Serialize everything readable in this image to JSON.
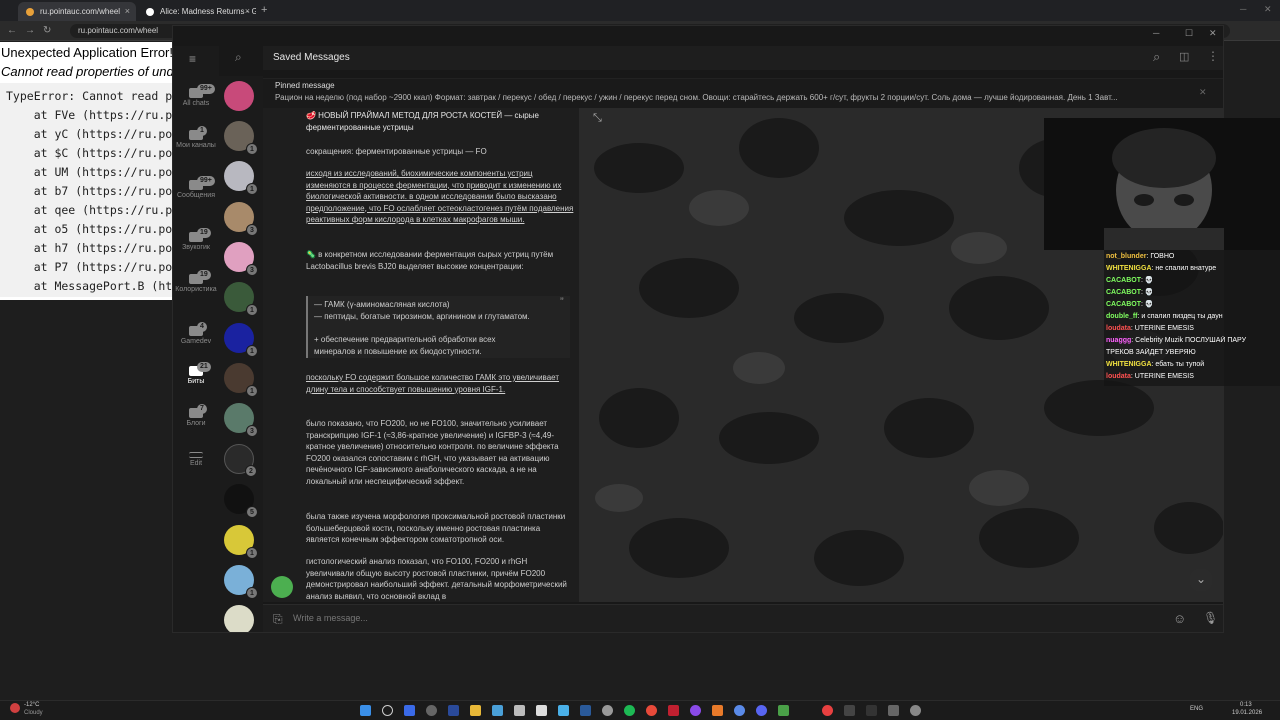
{
  "browser": {
    "tabs": [
      {
        "label": "ru.pointauc.com/wheel"
      },
      {
        "label": "Alice: Madness Returns - Googl"
      }
    ],
    "url": "ru.pointauc.com/wheel"
  },
  "error_page": {
    "title": "Unexpected Application Error!",
    "subtitle": "Cannot read properties of und",
    "trace": [
      "TypeError: Cannot read pr",
      "    at FVe (https://ru.po",
      "    at yC (https://ru.poi",
      "    at $C (https://ru.poi",
      "    at UM (https://ru.poi",
      "    at b7 (https://ru.poi",
      "    at qee (https://ru.po",
      "    at o5 (https://ru.poi",
      "    at h7 (https://ru.poi",
      "    at P7 (https://ru.poi",
      "    at MessagePort.B (htt"
    ]
  },
  "telegram": {
    "chat_title": "Saved Messages",
    "folders": [
      {
        "label": "All chats",
        "badge": "99+"
      },
      {
        "label": "Мои каналы",
        "badge": "1"
      },
      {
        "label": "Сообщения",
        "badge": "99+"
      },
      {
        "label": "Звукогик",
        "badge": "19"
      },
      {
        "label": "Колористика",
        "badge": "19"
      },
      {
        "label": "Gamedev",
        "badge": "4"
      },
      {
        "label": "Биты",
        "badge": "21"
      },
      {
        "label": "Блоги",
        "badge": "7"
      },
      {
        "label": "Edit",
        "badge": ""
      }
    ],
    "chat_badges": [
      "",
      "1",
      "1",
      "3",
      "3",
      "1",
      "1",
      "1",
      "3",
      "2",
      "5",
      "1",
      "1",
      ""
    ],
    "pinned_label": "Pinned message",
    "pinned_text": "Рацион на неделю (под набор ~2900 ккал)  Формат: завтрак / перекус / обед / перекус / ужин / перекус перед сном. Овощи: старайтесь держать 600+ г/сут, фрукты 2 порции/сут. Соль дома — лучше йодированная.  День 1  Завт...",
    "messages": {
      "title": "🥩 НОВЫЙ ПРАЙМАЛ МЕТОД ДЛЯ РОСТА КОСТЕЙ — сырые ферментированные устрицы",
      "abbr": "сокращения: ферментированные устрицы — FO",
      "p1": "исходя из исследований, биохимические компоненты устриц изменяются в процессе ферментации, что приводит к изменению их биологической активности. в одном исследовании было высказано предположение, что FO ослабляет остеокластогенез путём подавления реактивных форм кислорода в клетках макрофагов мыши.",
      "p2": "🦠 в конкретном исследовании ферментация сырых устриц путём Lactobacillus brevis BJ20 выделяет высокие концентрации:",
      "quote1": "— ГАМК (γ-аминомасляная кислота)",
      "quote2": "— пептиды, богатые тирозином, аргинином и глутаматом.",
      "quote3": "+ обеспечение предварительной обработки всех минералов и повышение их биодоступности.",
      "p3": "поскольку FO содержит большое количество ГАМК это увеличивает длину тела и способствует повышению уровня IGF-1.",
      "p4": "было показано, что FO200, но не FO100, значительно усиливает транскрипцию IGF-1 (≈3,86-кратное увеличение) и IGFBP-3 (≈4,49-кратное увеличение) относительно контроля. по величине эффекта FO200 оказался сопоставим с rhGH, что указывает на активацию печёночного IGF-зависимого анаболического каскада, а не на локальный или неспецифический эффект.",
      "p5": "была также изучена морфология проксимальной ростовой пластинки большеберцовой кости, поскольку именно ростовая пластинка является конечным эффектором соматотропной оси.",
      "p6": "гистологический анализ показал, что FO100, FO200 и rhGH увеличивали общую высоту ростовой пластинки, причём FO200 демонстрировал наибольший эффект. детальный морфометрический анализ выявил, что основной вклад в"
    },
    "composer_placeholder": "Write a message..."
  },
  "stream_chat": [
    {
      "name": "not_blunder",
      "color": "#f0c040",
      "text": "ГОВНО"
    },
    {
      "name": "WHITENIGGA",
      "color": "#f0e040",
      "text": "не спалил внатуре"
    },
    {
      "name": "CACABOT",
      "color": "#80ff60",
      "text": "💀"
    },
    {
      "name": "CACABOT",
      "color": "#80ff60",
      "text": "💀"
    },
    {
      "name": "CACABOT",
      "color": "#80ff60",
      "text": "💀"
    },
    {
      "name": "double_ff",
      "color": "#80ff60",
      "text": "и спалил пиздец ты даун"
    },
    {
      "name": "loudata",
      "color": "#ff5050",
      "text": "UTERINE EMESIS"
    },
    {
      "name": "nuaggg",
      "color": "#ff60ff",
      "text": "Celebrity Muzik ПОСЛУШАЙ ПАРУ"
    },
    {
      "name": "",
      "color": "#ffffff",
      "text": "ТРЕКОВ ЗАЙДЕТ УВЕРЯЮ"
    },
    {
      "name": "WHITENIGGA",
      "color": "#f0e040",
      "text": "ебать ты тупой"
    },
    {
      "name": "loudata",
      "color": "#ff5050",
      "text": "UTERINE EMESIS"
    }
  ],
  "taskbar": {
    "weather_temp": "-12°C",
    "weather_desc": "Cloudy",
    "lang": "ENG",
    "time": "0:13",
    "date": "19.01.2026"
  },
  "colors": {
    "accent": "#4caf50",
    "stream_bg": "#2a2a2a"
  }
}
